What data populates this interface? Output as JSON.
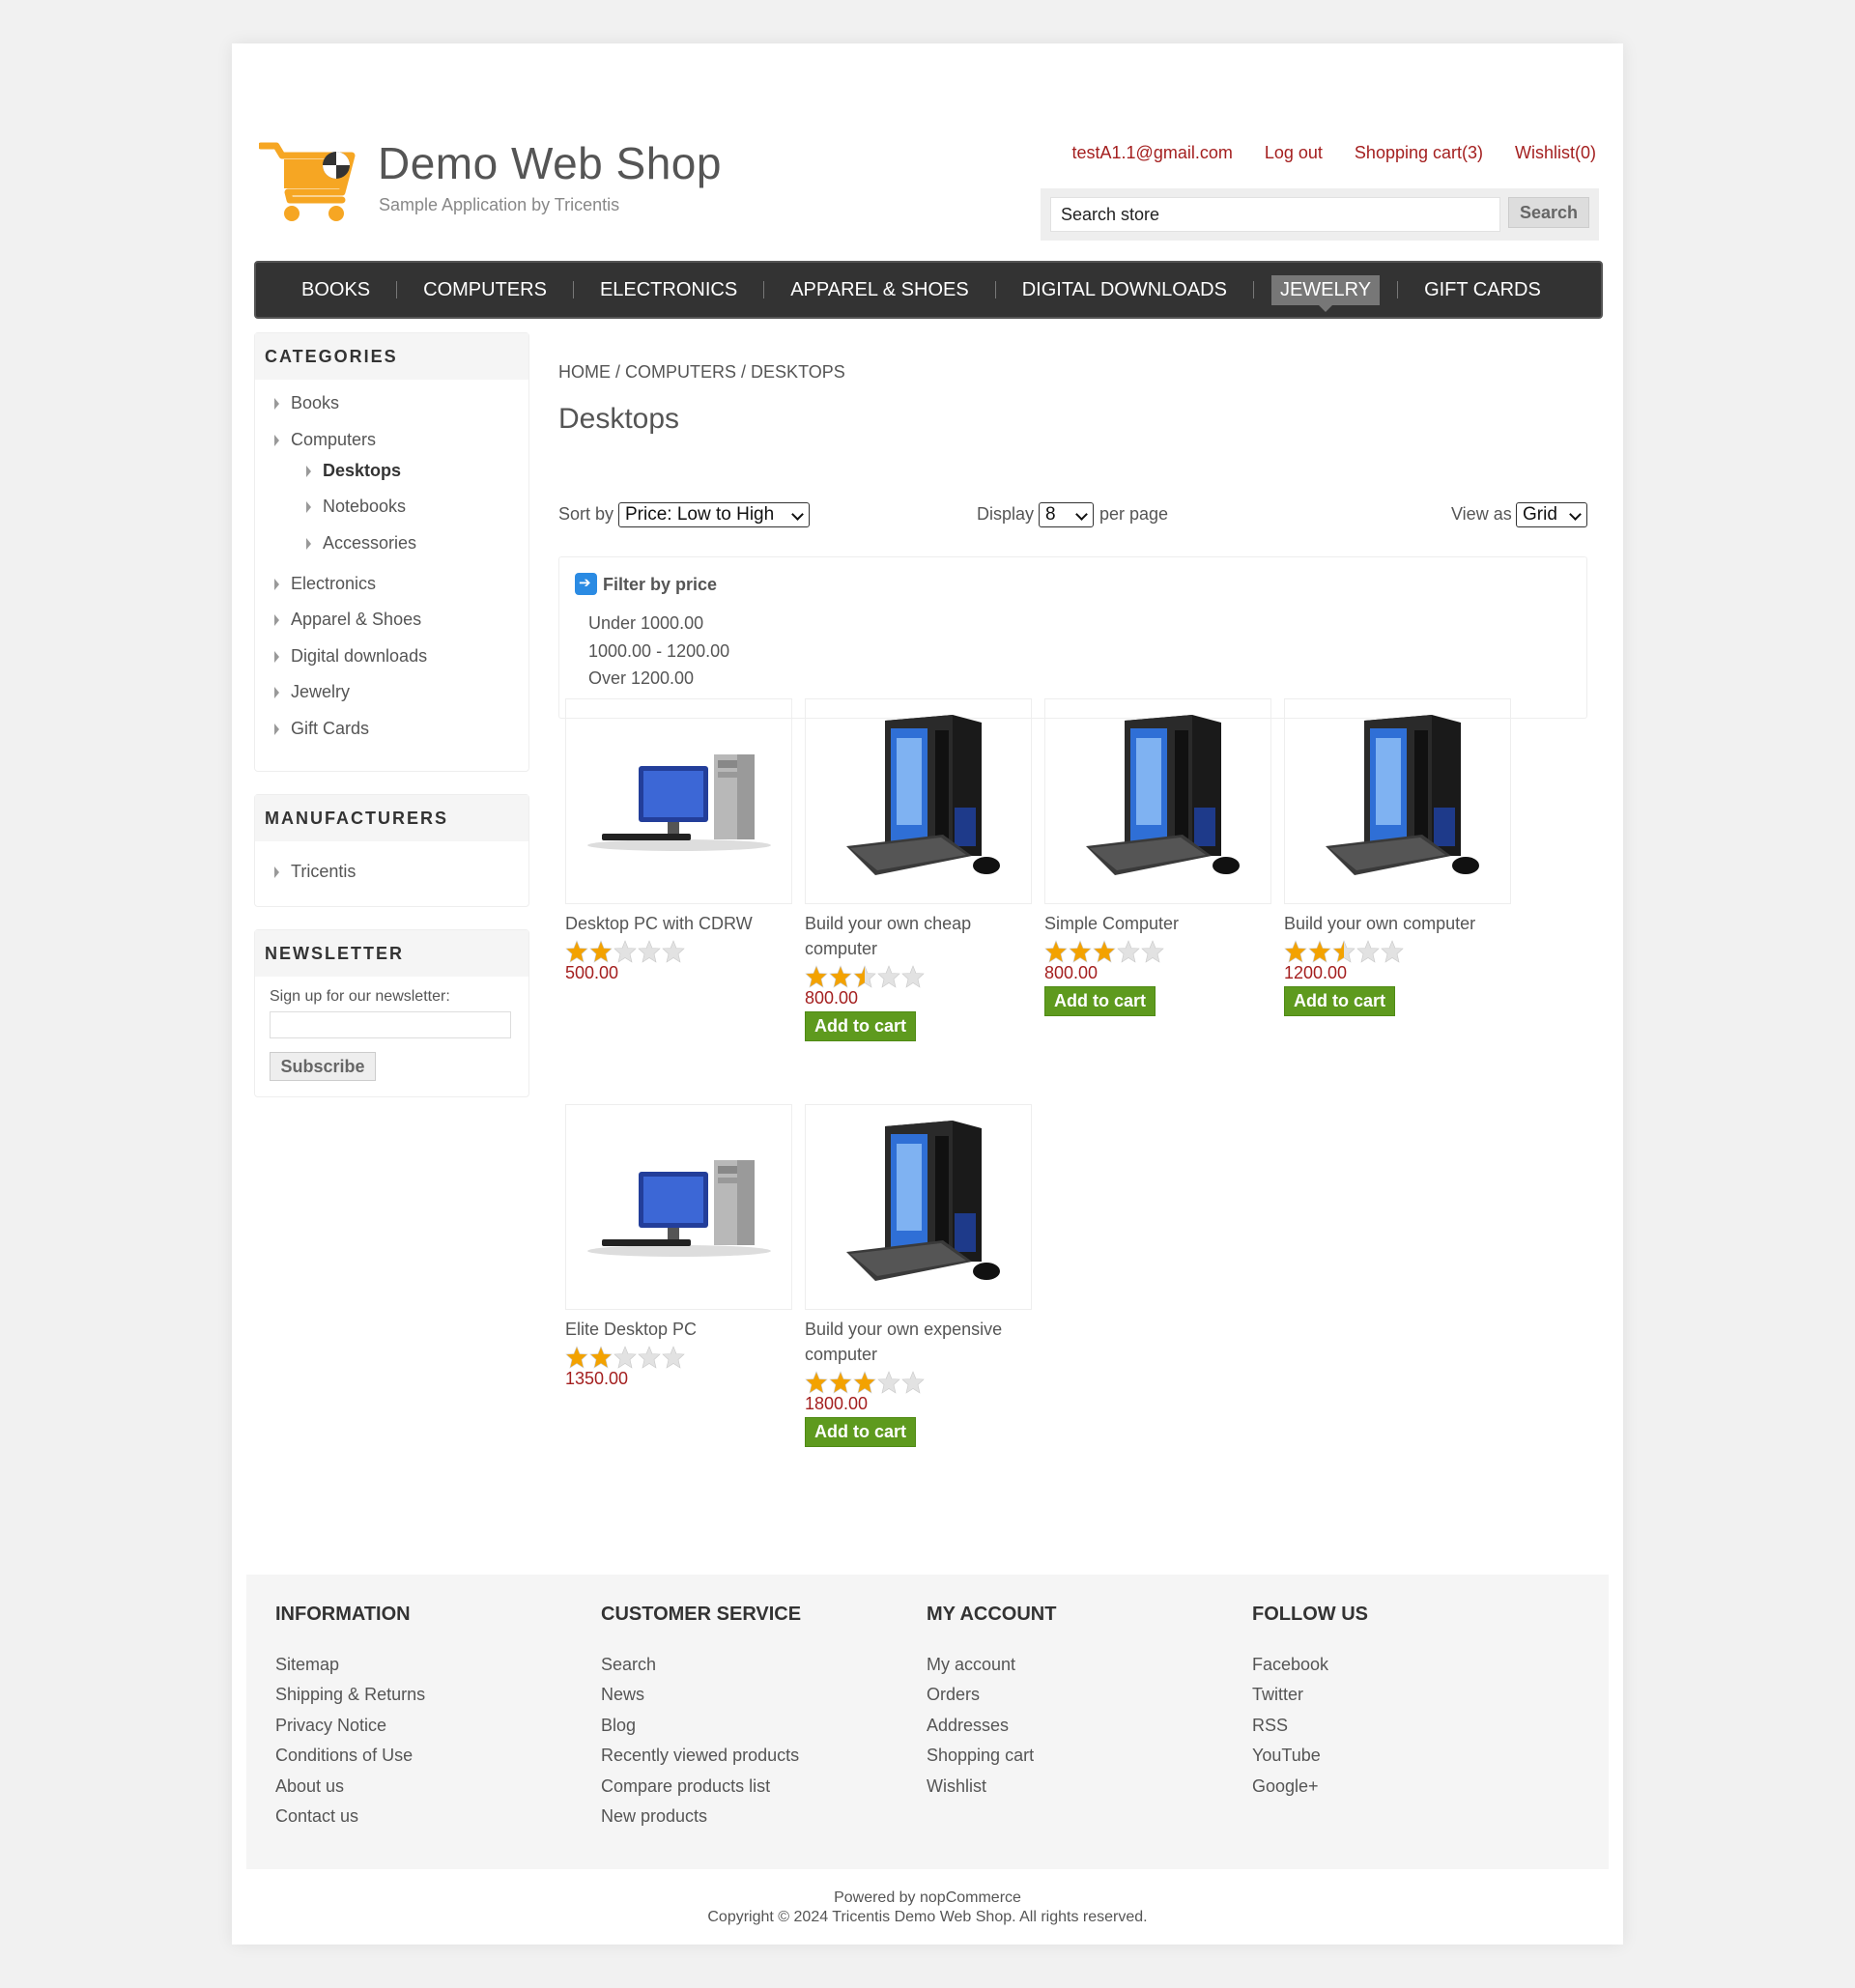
{
  "header": {
    "logo_title": "Demo Web Shop",
    "logo_subtitle": "Sample Application by Tricentis",
    "links": [
      "testA1.1@gmail.com",
      "Log out",
      "Shopping cart(3)",
      "Wishlist(0)"
    ],
    "search_placeholder": "Search store",
    "search_button": "Search"
  },
  "menu": [
    "BOOKS",
    "COMPUTERS",
    "ELECTRONICS",
    "APPAREL & SHOES",
    "DIGITAL DOWNLOADS",
    "JEWELRY",
    "GIFT CARDS"
  ],
  "menu_active": "JEWELRY",
  "categories": {
    "title": "CATEGORIES",
    "items": [
      "Books",
      "Computers",
      "Desktops",
      "Notebooks",
      "Accessories",
      "Electronics",
      "Apparel & Shoes",
      "Digital downloads",
      "Jewelry",
      "Gift Cards"
    ]
  },
  "manufacturers": {
    "title": "MANUFACTURERS",
    "items": [
      "Tricentis"
    ]
  },
  "newsletter": {
    "title": "NEWSLETTER",
    "label": "Sign up for our newsletter:",
    "button": "Subscribe"
  },
  "breadcrumb": [
    "HOME",
    "COMPUTERS",
    "DESKTOPS"
  ],
  "breadcrumb_sep": "/",
  "page_title": "Desktops",
  "controls": {
    "sort_label": "Sort by",
    "sort_value": "Price: Low to High",
    "display_label": "Display",
    "display_value": "8",
    "per_page": "per page",
    "view_label": "View as",
    "view_value": "Grid"
  },
  "filter": {
    "title": "Filter by price",
    "options": [
      "Under 1000.00",
      "1000.00 - 1200.00",
      "Over 1200.00"
    ]
  },
  "products": [
    {
      "name": "Desktop PC with CDRW",
      "rating": 2,
      "price": "500.00",
      "add_to_cart": "",
      "image": "monitor-pc-icon"
    },
    {
      "name": "Build your own cheap computer",
      "rating": 2.5,
      "price": "800.00",
      "add_to_cart": "Add to cart",
      "image": "tower-pc-icon"
    },
    {
      "name": "Simple Computer",
      "rating": 3,
      "price": "800.00",
      "add_to_cart": "Add to cart",
      "image": "tower-pc-icon"
    },
    {
      "name": "Build your own computer",
      "rating": 2.5,
      "price": "1200.00",
      "add_to_cart": "Add to cart",
      "image": "tower-pc-icon"
    },
    {
      "name": "Elite Desktop PC",
      "rating": 2,
      "price": "1350.00",
      "add_to_cart": "",
      "image": "monitor-pc-icon"
    },
    {
      "name": "Build your own expensive computer",
      "rating": 3,
      "price": "1800.00",
      "add_to_cart": "Add to cart",
      "image": "tower-pc-icon"
    }
  ],
  "footer": {
    "columns": [
      {
        "title": "INFORMATION",
        "links": [
          "Sitemap",
          "Shipping & Returns",
          "Privacy Notice",
          "Conditions of Use",
          "About us",
          "Contact us"
        ]
      },
      {
        "title": "CUSTOMER SERVICE",
        "links": [
          "Search",
          "News",
          "Blog",
          "Recently viewed products",
          "Compare products list",
          "New products"
        ]
      },
      {
        "title": "MY ACCOUNT",
        "links": [
          "My account",
          "Orders",
          "Addresses",
          "Shopping cart",
          "Wishlist"
        ]
      },
      {
        "title": "FOLLOW US",
        "links": [
          "Facebook",
          "Twitter",
          "RSS",
          "YouTube",
          "Google+"
        ]
      }
    ],
    "powered": "Powered by nopCommerce",
    "copyright": "Copyright © 2024 Tricentis Demo Web Shop. All rights reserved."
  },
  "colors": {
    "link_red": "#a41f1f",
    "menu_bg": "#333333",
    "button_green": "#5e9a1e",
    "logo_orange": "#f6a623"
  }
}
